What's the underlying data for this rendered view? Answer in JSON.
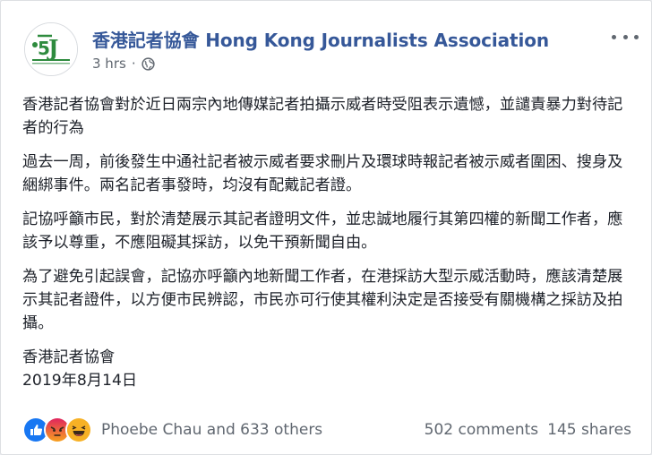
{
  "page": {
    "name": "香港記者協會 Hong Kong Journalists Association",
    "avatar_text": "香港記者協會",
    "time": "3 hrs",
    "separator": "·",
    "privacy_icon": "globe-icon",
    "more_icon": "more-options-icon"
  },
  "post": {
    "paragraphs": [
      "香港記者協會對於近日兩宗內地傳媒記者拍攝示威者時受阻表示遺憾，並譴責暴力對待記者的行為",
      "過去一周，前後發生中通社記者被示威者要求刪片及環球時報記者被示威者圍困、搜身及綑綁事件。兩名記者事發時，均沒有配戴記者證。",
      "記協呼籲市民，對於清楚展示其記者證明文件，並忠誠地履行其第四權的新聞工作者，應該予以尊重，不應阻礙其採訪，以免干預新聞自由。",
      "為了避免引起誤會，記協亦呼籲內地新聞工作者，在港採訪大型示威活動時，應該清楚展示其記者證件，以方便市民辨認，市民亦可行使其權利決定是否接受有關機構之採訪及拍攝。"
    ],
    "signature": "香港記者協會",
    "date": "2019年8月14日"
  },
  "footer": {
    "reactions": [
      "like-icon",
      "angry-icon",
      "haha-icon"
    ],
    "reactors": "Phoebe Chau and 633 others",
    "comments": "502 comments",
    "shares": "145 shares"
  },
  "colors": {
    "link_blue": "#365899",
    "meta_gray": "#606770",
    "like_blue": "#1877f2",
    "angry_red": "#e9710f",
    "haha_yellow": "#f7b125",
    "logo_green": "#2e8b3e"
  }
}
